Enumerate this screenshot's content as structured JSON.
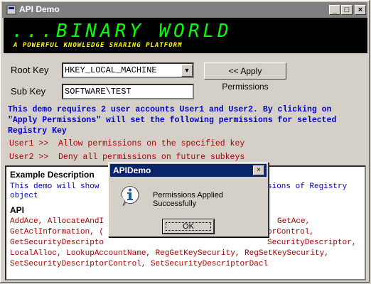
{
  "window": {
    "title": "API Demo",
    "controls": {
      "minimize": "_",
      "maximize": "□",
      "close": "×"
    }
  },
  "banner": {
    "title": "...BINARY WORLD",
    "tagline": "A POWERFUL KNOWLEDGE SHARING PLATFORM"
  },
  "form": {
    "root_key_label": "Root Key",
    "root_key_value": "HKEY_LOCAL_MACHINE",
    "sub_key_label": "Sub Key",
    "sub_key_value": "SOFTWARE\\TEST",
    "apply_button": "<< Apply Permissions"
  },
  "info": {
    "line1": "This demo requires 2 user accounts User1 and User2. By clicking on",
    "line2": "\"Apply Permissions\" will set the following permissions for selected",
    "line3": "Registry Key",
    "user1": "User1 >>  Allow permissions on the specified key",
    "user2": "User2 >>  Deny all permissions on future subkeys"
  },
  "panel": {
    "heading": "Example Description",
    "desc_line1_left": "This demo will show",
    "desc_line1_right": "sions of Registry",
    "desc_line2": "object",
    "api_heading": "API",
    "api_line1_left": "AddAce, AllocateAndI",
    "api_line1_right": "GetAce,",
    "api_line2_left": "GetAclInformation, (",
    "api_line2_right": "orControl,",
    "api_line3_left": "GetSecurityDescripto",
    "api_line3_right": "SecurityDescriptor,",
    "api_line4": "LocalAlloc, LookupAccountName, RegGetKeySecurity, RegSetKeySecurity,",
    "api_line5": "SetSecurityDescriptorControl, SetSecurityDescriptorDacl"
  },
  "dialog": {
    "title": "APIDemo",
    "close": "×",
    "message": "Permissions Applied Successfully",
    "ok": "OK",
    "icon": "information-icon"
  },
  "colors": {
    "accent_title": "#0a246a",
    "banner_green": "#00ff00",
    "banner_yellow": "#ffff00",
    "info_blue": "#0000cc",
    "perm_red": "#aa0000"
  }
}
